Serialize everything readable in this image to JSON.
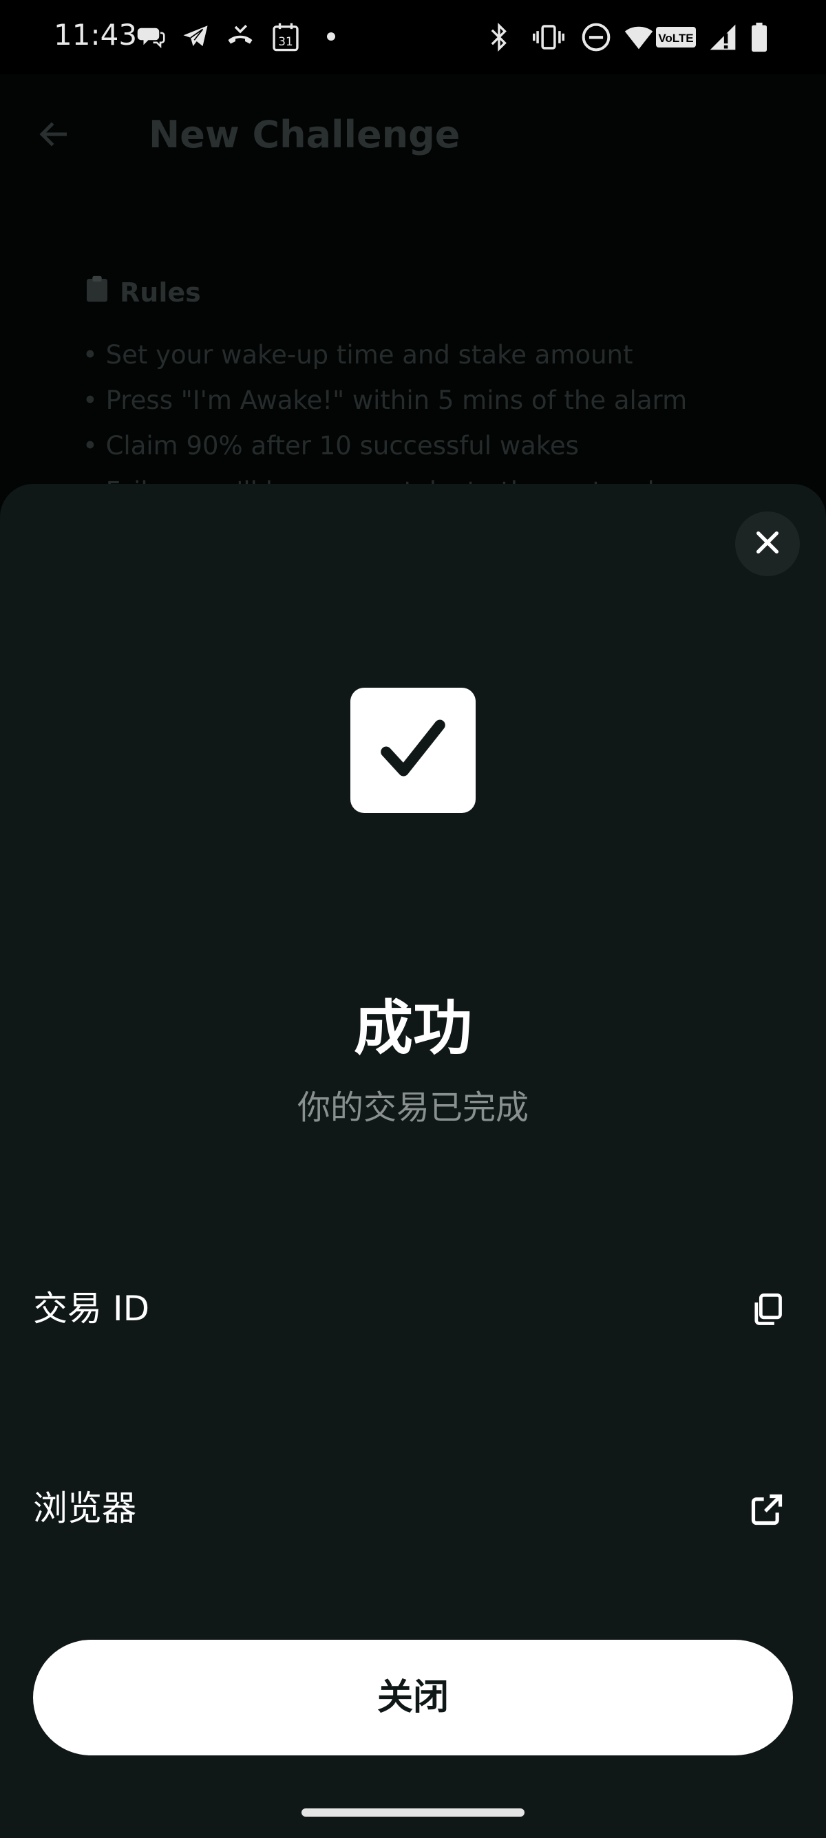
{
  "status_bar": {
    "time": "11:43",
    "calendar_day": "31",
    "network_label": "VoLTE",
    "icons_left": [
      "chat-bubble-icon",
      "telegram-icon",
      "missed-call-icon",
      "calendar-icon",
      "dot-icon"
    ],
    "icons_right": [
      "bluetooth-icon",
      "vibrate-icon",
      "do-not-disturb-icon",
      "wifi-icon",
      "volte-icon",
      "signal-icon",
      "battery-icon"
    ]
  },
  "background_page": {
    "title": "New Challenge",
    "rules_heading": "Rules",
    "rules": [
      "Set your wake-up time and stake amount",
      "Press \"I'm Awake!\" within 5 mins of the alarm",
      "Claim 90% after 10 successful wakes",
      "Fail — you'll lose your stake to the protocol"
    ]
  },
  "sheet": {
    "title": "成功",
    "subtitle": "你的交易已完成",
    "rows": [
      {
        "label": "交易 ID",
        "icon": "copy-icon"
      },
      {
        "label": "浏览器",
        "icon": "external-link-icon"
      }
    ],
    "close_button_label": "关闭"
  },
  "colors": {
    "sheet_background": "#0f1717",
    "page_background": "#030505",
    "primary_text": "#ffffff",
    "secondary_text": "#8a9090",
    "button_background": "#ffffff"
  }
}
